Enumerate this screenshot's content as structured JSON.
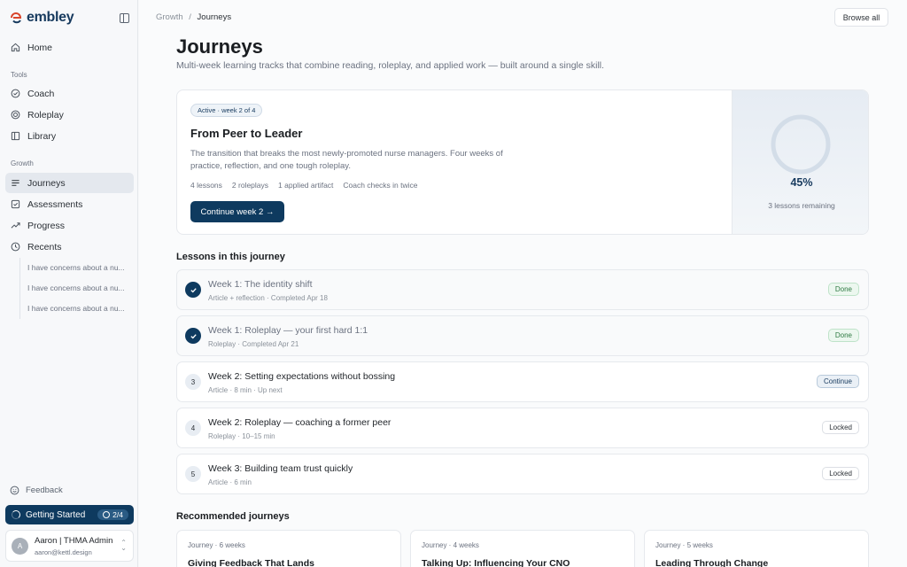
{
  "brand": {
    "name": "embley"
  },
  "nav": {
    "home": "Home",
    "tools_label": "Tools",
    "coach": "Coach",
    "roleplay": "Roleplay",
    "library": "Library",
    "growth_label": "Growth",
    "journeys": "Journeys",
    "assessments": "Assessments",
    "progress": "Progress",
    "recents": "Recents",
    "recent_items": [
      "I have concerns about a nu...",
      "I have concerns about a nu...",
      "I have concerns about a nu..."
    ]
  },
  "footer": {
    "feedback": "Feedback",
    "getting_started": "Getting Started",
    "getting_started_count": "2/4",
    "user_name": "Aaron | THMA Admin",
    "user_email": "aaron@kettl.design",
    "avatar_initial": "A"
  },
  "breadcrumb": {
    "parent": "Growth",
    "separator": "/",
    "current": "Journeys"
  },
  "header": {
    "browse_all": "Browse all"
  },
  "page": {
    "title": "Journeys",
    "subtitle": "Multi-week learning tracks that combine reading, roleplay, and applied work — built around a single skill."
  },
  "active_journey": {
    "badge": "Active · week 2 of 4",
    "title": "From Peer to Leader",
    "description": "The transition that breaks the most newly-promoted nurse managers. Four weeks of practice, reflection, and one tough roleplay.",
    "meta": [
      "4 lessons",
      "2 roleplays",
      "1 applied artifact",
      "Coach checks in twice"
    ],
    "cta": "Continue week 2 →",
    "progress_percent": 45,
    "progress_label": "45%",
    "remaining": "3 lessons remaining"
  },
  "lessons": {
    "heading": "Lessons in this journey",
    "items": [
      {
        "marker": "",
        "title": "Week 1: The identity shift",
        "sub": "Article + reflection · Completed Apr 18",
        "status": "Done"
      },
      {
        "marker": "",
        "title": "Week 1: Roleplay — your first hard 1:1",
        "sub": "Roleplay · Completed Apr 21",
        "status": "Done"
      },
      {
        "marker": "3",
        "title": "Week 2: Setting expectations without bossing",
        "sub": "Article · 8 min · Up next",
        "status": "Continue"
      },
      {
        "marker": "4",
        "title": "Week 2: Roleplay — coaching a former peer",
        "sub": "Roleplay · 10–15 min",
        "status": "Locked"
      },
      {
        "marker": "5",
        "title": "Week 3: Building team trust quickly",
        "sub": "Article · 6 min",
        "status": "Locked"
      }
    ]
  },
  "recommended": {
    "heading": "Recommended journeys",
    "items": [
      {
        "meta": "Journey · 6 weeks",
        "title": "Giving Feedback That Lands"
      },
      {
        "meta": "Journey · 4 weeks",
        "title": "Talking Up: Influencing Your CNO"
      },
      {
        "meta": "Journey · 5 weeks",
        "title": "Leading Through Change"
      }
    ]
  },
  "colors": {
    "accent": "#0e3a5f",
    "done": "#2f7a43",
    "sidebar_bg": "#f7f8fa"
  }
}
